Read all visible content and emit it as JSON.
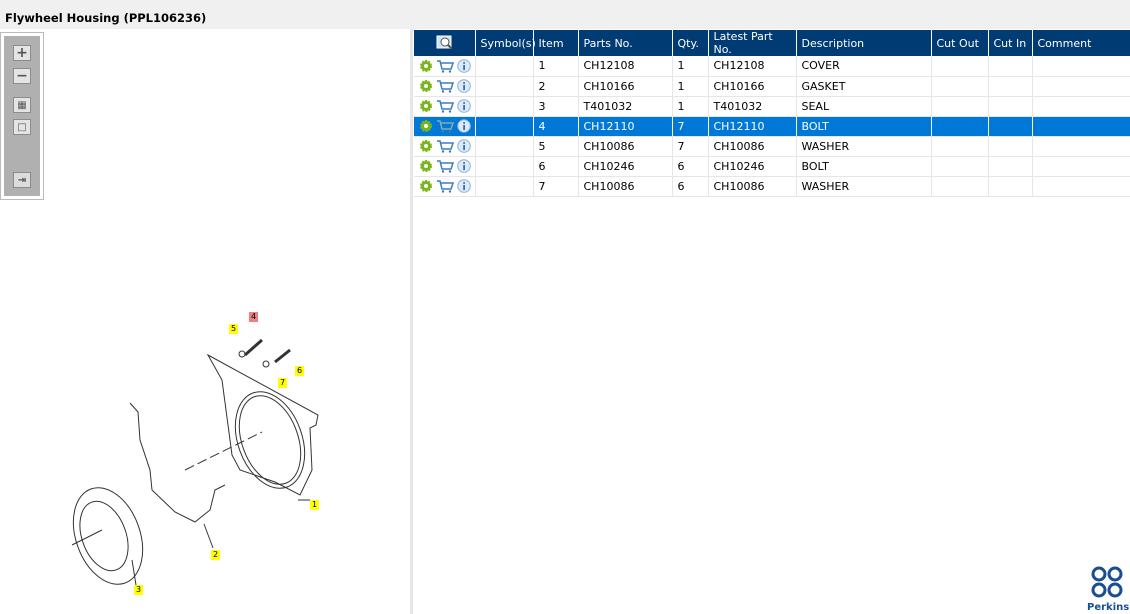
{
  "title": "Flywheel Housing (PPL106236)",
  "toolbar": {
    "zoom_in": "zoom-in",
    "zoom_out": "zoom-out",
    "fit": "fit-all",
    "actual": "actual-size",
    "export": "export-list"
  },
  "columns": [
    "Symbol(s)",
    "Item",
    "Parts No.",
    "Qty.",
    "Latest Part No.",
    "Description",
    "Cut Out",
    "Cut In",
    "Comment"
  ],
  "rows": [
    {
      "symbol": "",
      "item": "1",
      "part": "CH12108",
      "qty": "1",
      "latest": "CH12108",
      "desc": "COVER",
      "cut_out": "",
      "cut_in": "",
      "comment": ""
    },
    {
      "symbol": "",
      "item": "2",
      "part": "CH10166",
      "qty": "1",
      "latest": "CH10166",
      "desc": "GASKET",
      "cut_out": "",
      "cut_in": "",
      "comment": ""
    },
    {
      "symbol": "",
      "item": "3",
      "part": "T401032",
      "qty": "1",
      "latest": "T401032",
      "desc": "SEAL",
      "cut_out": "",
      "cut_in": "",
      "comment": ""
    },
    {
      "symbol": "",
      "item": "4",
      "part": "CH12110",
      "qty": "7",
      "latest": "CH12110",
      "desc": "BOLT",
      "cut_out": "",
      "cut_in": "",
      "comment": "",
      "selected": true
    },
    {
      "symbol": "",
      "item": "5",
      "part": "CH10086",
      "qty": "7",
      "latest": "CH10086",
      "desc": "WASHER",
      "cut_out": "",
      "cut_in": "",
      "comment": ""
    },
    {
      "symbol": "",
      "item": "6",
      "part": "CH10246",
      "qty": "6",
      "latest": "CH10246",
      "desc": "BOLT",
      "cut_out": "",
      "cut_in": "",
      "comment": ""
    },
    {
      "symbol": "",
      "item": "7",
      "part": "CH10086",
      "qty": "6",
      "latest": "CH10086",
      "desc": "WASHER",
      "cut_out": "",
      "cut_in": "",
      "comment": ""
    }
  ],
  "callouts": [
    "1",
    "2",
    "3",
    "4",
    "5",
    "6",
    "7"
  ],
  "highlighted_callout": "4",
  "logo": "Perkins",
  "colors": {
    "header": "#003b73",
    "selected": "#0078d7",
    "callout": "#ffff00",
    "callout_selected": "#f08080"
  }
}
